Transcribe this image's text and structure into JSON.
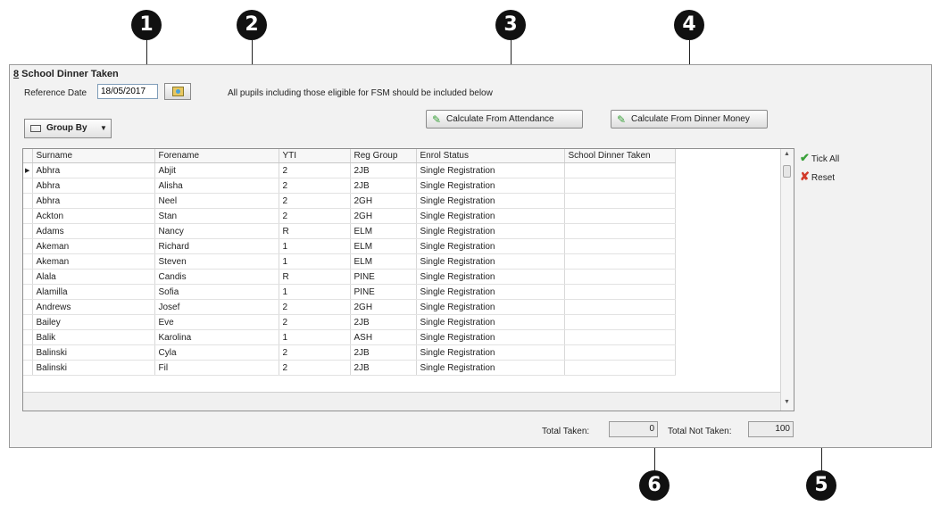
{
  "callouts": [
    "1",
    "2",
    "3",
    "4",
    "5",
    "6"
  ],
  "panel": {
    "title_key": "8",
    "title_rest": " School Dinner Taken",
    "reference_label": "Reference Date",
    "reference_date": "18/05/2017",
    "info": "All pupils including those eligible for FSM should be included below",
    "group_by": "Group By",
    "buttons": {
      "attendance": "Calculate From Attendance",
      "dinner_money": "Calculate From Dinner Money"
    },
    "side_actions": {
      "tick_all": "Tick All",
      "reset": "Reset"
    },
    "totals": {
      "taken_label": "Total Taken:",
      "taken": "0",
      "not_taken_label": "Total Not Taken:",
      "not_taken": "100"
    }
  },
  "grid": {
    "columns": [
      "Surname",
      "Forename",
      "YTI",
      "Reg Group",
      "Enrol Status",
      "School Dinner Taken"
    ],
    "rows": [
      [
        "Abhra",
        "Abjit",
        "2",
        "2JB",
        "Single Registration",
        ""
      ],
      [
        "Abhra",
        "Alisha",
        "2",
        "2JB",
        "Single Registration",
        ""
      ],
      [
        "Abhra",
        "Neel",
        "2",
        "2GH",
        "Single Registration",
        ""
      ],
      [
        "Ackton",
        "Stan",
        "2",
        "2GH",
        "Single Registration",
        ""
      ],
      [
        "Adams",
        "Nancy",
        "R",
        "ELM",
        "Single Registration",
        ""
      ],
      [
        "Akeman",
        "Richard",
        "1",
        "ELM",
        "Single Registration",
        ""
      ],
      [
        "Akeman",
        "Steven",
        "1",
        "ELM",
        "Single Registration",
        ""
      ],
      [
        "Alala",
        "Candis",
        "R",
        "PINE",
        "Single Registration",
        ""
      ],
      [
        "Alamilla",
        "Sofia",
        "1",
        "PINE",
        "Single Registration",
        ""
      ],
      [
        "Andrews",
        "Josef",
        "2",
        "2GH",
        "Single Registration",
        ""
      ],
      [
        "Bailey",
        "Eve",
        "2",
        "2JB",
        "Single Registration",
        ""
      ],
      [
        "Balik",
        "Karolina",
        "1",
        "ASH",
        "Single Registration",
        ""
      ],
      [
        "Balinski",
        "Cyla",
        "2",
        "2JB",
        "Single Registration",
        ""
      ],
      [
        "Balinski",
        "Fil",
        "2",
        "2JB",
        "Single Registration",
        ""
      ]
    ]
  }
}
